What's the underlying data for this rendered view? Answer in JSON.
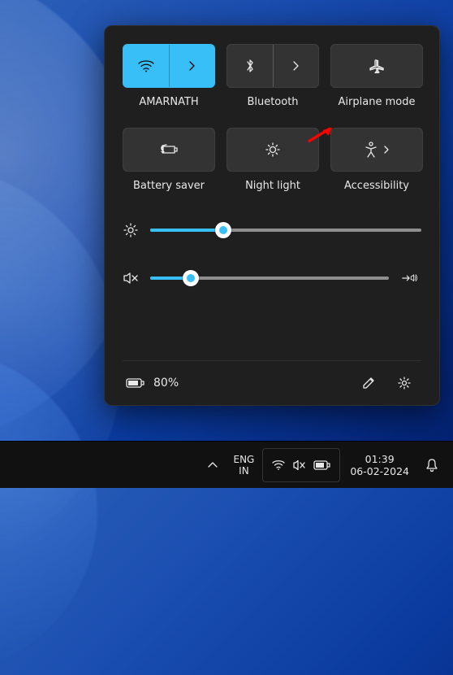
{
  "tiles": {
    "wifi": {
      "label": "AMARNATH",
      "active": true
    },
    "bluetooth": {
      "label": "Bluetooth",
      "active": false
    },
    "airplane": {
      "label": "Airplane mode",
      "active": false
    },
    "battery": {
      "label": "Battery saver",
      "active": false
    },
    "night": {
      "label": "Night light",
      "active": false
    },
    "access": {
      "label": "Accessibility",
      "active": false
    }
  },
  "sliders": {
    "brightness": {
      "percent": 27
    },
    "volume": {
      "percent": 17,
      "muted": true
    }
  },
  "footer": {
    "battery_text": "80%"
  },
  "taskbar": {
    "lang_top": "ENG",
    "lang_bottom": "IN",
    "time": "01:39",
    "date": "06-02-2024"
  }
}
